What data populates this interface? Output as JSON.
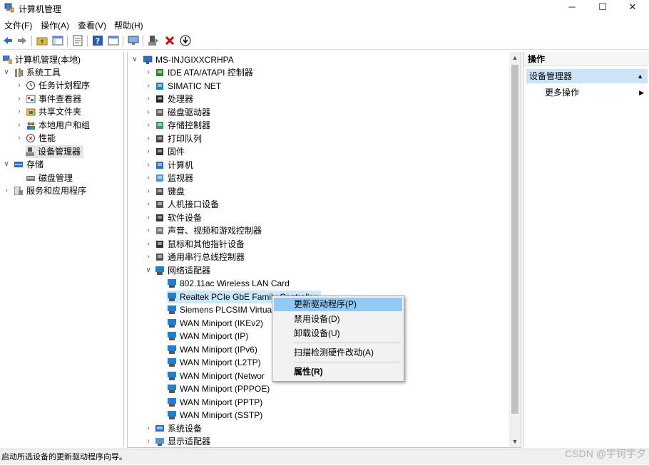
{
  "window": {
    "title": "计算机管理",
    "min_glyph": "─",
    "max_glyph": "☐",
    "close_glyph": "✕"
  },
  "menubar": [
    "文件(F)",
    "操作(A)",
    "查看(V)",
    "帮助(H)"
  ],
  "left_tree": {
    "root": "计算机管理(本地)",
    "system_tools": "系统工具",
    "children": [
      "任务计划程序",
      "事件查看器",
      "共享文件夹",
      "本地用户和组",
      "性能",
      "设备管理器"
    ],
    "storage": "存储",
    "disk_mgmt": "磁盘管理",
    "services": "服务和应用程序"
  },
  "device_tree": {
    "computer": "MS-INJGIXXCRHPA",
    "categories": [
      "IDE ATA/ATAPI 控制器",
      "SIMATIC NET",
      "处理器",
      "磁盘驱动器",
      "存储控制器",
      "打印队列",
      "固件",
      "计算机",
      "监视器",
      "键盘",
      "人机接口设备",
      "软件设备",
      "声音、视频和游戏控制器",
      "鼠标和其他指针设备",
      "通用串行总线控制器"
    ],
    "network_category": "网络适配器",
    "adapters": [
      "802.11ac Wireless LAN Card",
      "Realtek PCIe GbE Family Controller",
      "Siemens PLCSIM Virtua",
      "WAN Miniport (IKEv2)",
      "WAN Miniport (IP)",
      "WAN Miniport (IPv6)",
      "WAN Miniport (L2TP)",
      "WAN Miniport (Networ",
      "WAN Miniport (PPPOE)",
      "WAN Miniport (PPTP)",
      "WAN Miniport (SSTP)"
    ],
    "after": [
      "系统设备",
      "显示适配器"
    ]
  },
  "context_menu": {
    "update": "更新驱动程序(P)",
    "disable": "禁用设备(D)",
    "uninstall": "卸载设备(U)",
    "scan": "扫描检测硬件改动(A)",
    "properties": "属性(R)"
  },
  "actions": {
    "header": "操作",
    "section": "设备管理器",
    "more": "更多操作"
  },
  "status": "启动所选设备的更新驱动程序向导。",
  "watermark": "CSDN @宇钶宇夕",
  "colors": {
    "selection": "#cce8ff",
    "menu_highlight": "#91c9f7",
    "action_section": "#cce4f7",
    "network_icon": "#1e7fd6",
    "delete_red": "#d40000"
  }
}
